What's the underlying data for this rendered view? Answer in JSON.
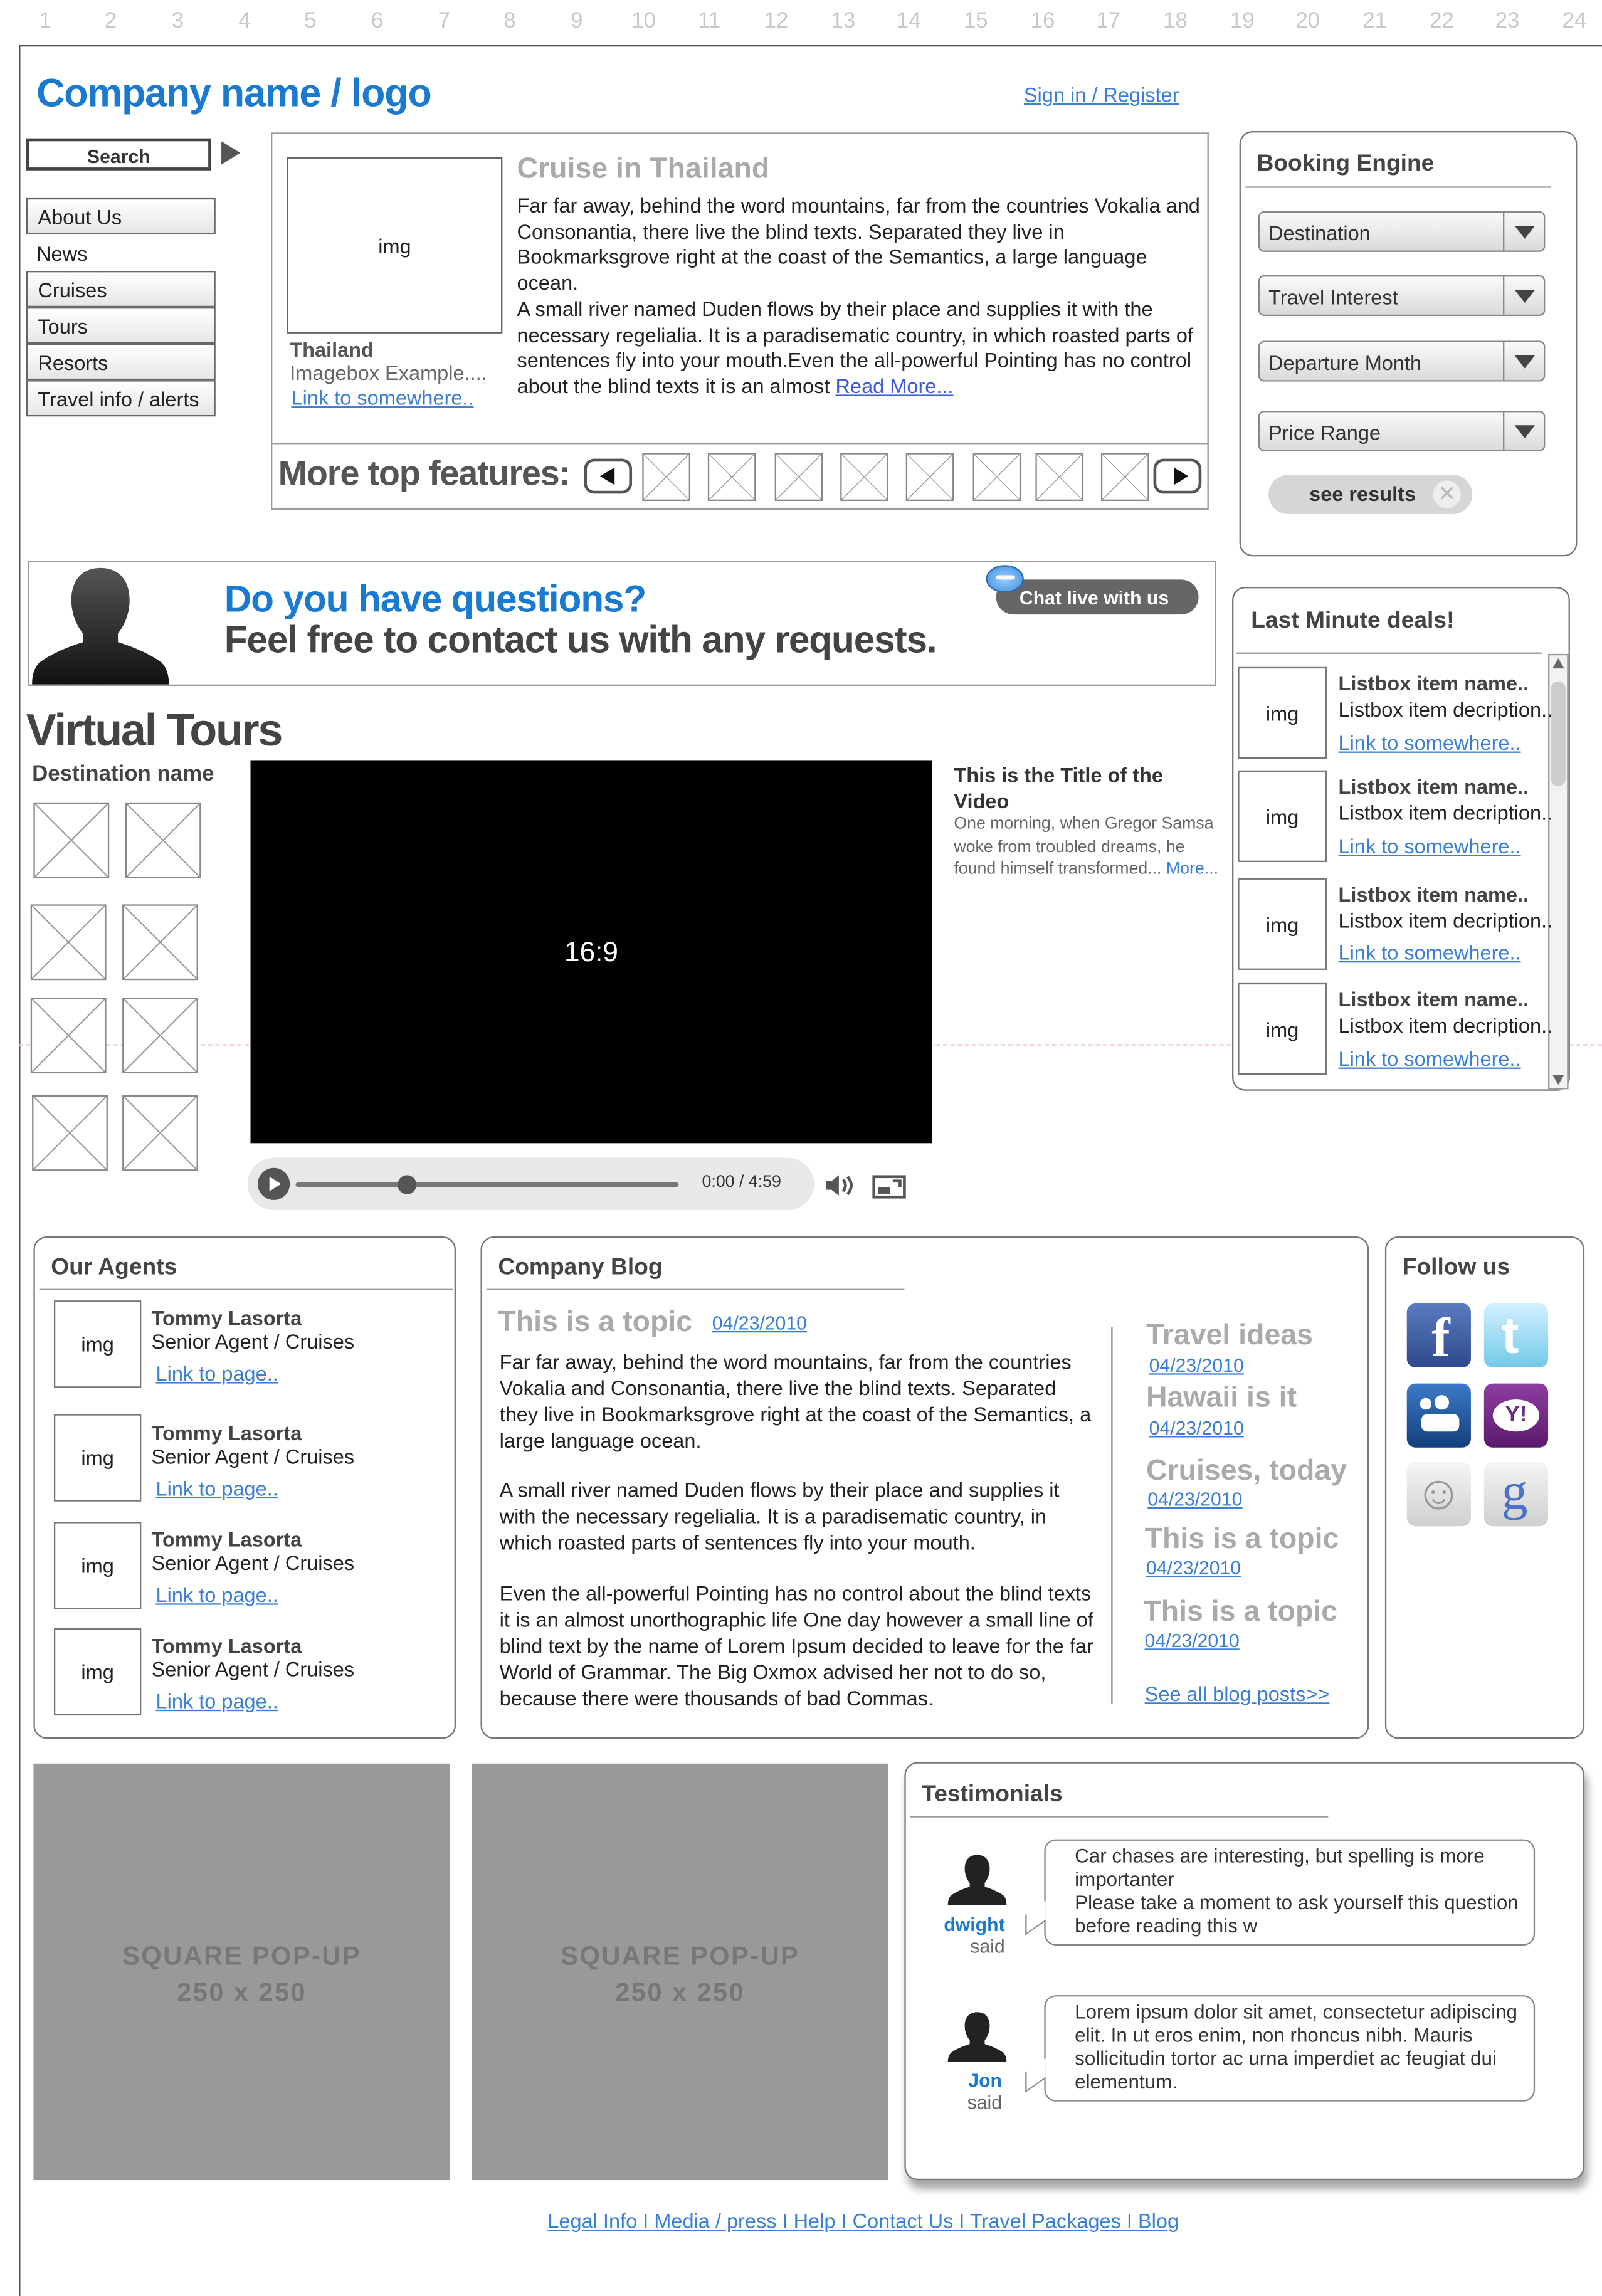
{
  "grid": [
    "1",
    "2",
    "3",
    "4",
    "5",
    "6",
    "7",
    "8",
    "9",
    "10",
    "11",
    "12",
    "13",
    "14",
    "15",
    "16",
    "17",
    "18",
    "19",
    "20",
    "21",
    "22",
    "23",
    "24"
  ],
  "header": {
    "logo": "Company name / logo",
    "signin": "Sign in / Register"
  },
  "search": {
    "label": "Search"
  },
  "nav": [
    "About Us",
    "News",
    "Cruises",
    "Tours",
    "Resorts",
    "Travel info / alerts"
  ],
  "feature": {
    "img": "img",
    "title": "Cruise in Thailand",
    "caption_title": "Thailand",
    "caption_text": "Imagebox Example....",
    "caption_link": "Link to somewhere..",
    "para1": "Far far away, behind the word mountains, far from the countries Vokalia and Consonantia, there live the blind texts. Separated they live in Bookmarksgrove right at the coast of the Semantics, a large language ocean.",
    "para2": "A small river named Duden flows by their place and supplies it with the necessary regelialia. It is a paradisematic country, in which roasted parts of sentences fly into your mouth.Even the all-powerful Pointing has no control about the blind texts it is an almost",
    "read_more": "Read More...",
    "more_label": "More top features:"
  },
  "booking": {
    "title": "Booking Engine",
    "selects": [
      "Destination",
      "Travel Interest",
      "Departure Month",
      "Price Range"
    ],
    "button": "see results"
  },
  "contact": {
    "q": "Do you have questions?",
    "sub": "Feel free to contact us with any requests.",
    "chat": "Chat live with us"
  },
  "deals": {
    "title": "Last Minute deals!",
    "items": [
      {
        "img": "img",
        "name": "Listbox item name..",
        "desc": "Listbox item decription...",
        "link": "Link to somewhere.."
      },
      {
        "img": "img",
        "name": "Listbox item name..",
        "desc": "Listbox item decription...",
        "link": "Link to somewhere.."
      },
      {
        "img": "img",
        "name": "Listbox item name..",
        "desc": "Listbox item decription...",
        "link": "Link to somewhere.."
      },
      {
        "img": "img",
        "name": "Listbox item name..",
        "desc": "Listbox item decription...",
        "link": "Link to somewhere.."
      }
    ]
  },
  "tours": {
    "heading": "Virtual Tours",
    "dest": "Destination name",
    "ratio": "16:9",
    "video_title": "This is the Title of the Video",
    "video_desc": "One morning, when Gregor Samsa woke from troubled dreams, he found himself transformed...",
    "video_more": "More...",
    "time_current": "0:00",
    "time_sep": "/",
    "time_total": "4:59",
    "progress": 0.29
  },
  "agents": {
    "title": "Our Agents",
    "items": [
      {
        "img": "img",
        "name": "Tommy Lasorta",
        "role": "Senior Agent  / Cruises",
        "link": "Link to page.."
      },
      {
        "img": "img",
        "name": "Tommy Lasorta",
        "role": "Senior Agent  / Cruises",
        "link": "Link to page.."
      },
      {
        "img": "img",
        "name": "Tommy Lasorta",
        "role": "Senior Agent  / Cruises",
        "link": "Link to page.."
      },
      {
        "img": "img",
        "name": "Tommy Lasorta",
        "role": "Senior Agent  / Cruises",
        "link": "Link to page.."
      }
    ]
  },
  "blog": {
    "title": "Company Blog",
    "topic": "This is a topic",
    "date": "04/23/2010",
    "p1": "Far far away, behind the word mountains, far from the countries Vokalia and Consonantia, there live the blind texts. Separated they live in Bookmarksgrove right at the coast of the Semantics, a large language ocean.",
    "p2": "A small river named Duden flows by their place and supplies it with the necessary regelialia. It is a paradisematic country, in which roasted parts of sentences fly into your mouth.",
    "p3": "Even the all-powerful Pointing has no control about the blind texts it is an almost unorthographic life One day however a small line of blind text by the name of Lorem Ipsum decided to leave for the far World of Grammar. The Big Oxmox advised her not to do so, because there were thousands of bad Commas.",
    "side": [
      {
        "t": "Travel ideas",
        "d": "04/23/2010"
      },
      {
        "t": "Hawaii is it",
        "d": "04/23/2010"
      },
      {
        "t": "Cruises, today",
        "d": "04/23/2010"
      },
      {
        "t": "This is a topic",
        "d": "04/23/2010"
      },
      {
        "t": "This is a topic",
        "d": "04/23/2010"
      }
    ],
    "see_all": "See all blog posts>>"
  },
  "follow": {
    "title": "Follow us",
    "icons": [
      "facebook-icon",
      "twitter-icon",
      "myspace-icon",
      "yahoo-icon",
      "smiley-icon",
      "google-icon"
    ]
  },
  "popups": [
    {
      "l1": "SQUARE POP-UP",
      "l2": "250 x 250"
    },
    {
      "l1": "SQUARE POP-UP",
      "l2": "250 x 250"
    }
  ],
  "testimonials": {
    "title": "Testimonials",
    "items": [
      {
        "text": "Car chases are interesting, but spelling is more importanter\nPlease take a moment to ask yourself this question before reading this w",
        "name": "dwight",
        "said": "said"
      },
      {
        "text": "Lorem ipsum dolor sit amet, consectetur adipiscing elit. In ut eros enim, non rhoncus nibh. Mauris sollicitudin tortor ac urna imperdiet ac feugiat dui elementum.",
        "name": "Jon",
        "said": "said"
      }
    ]
  },
  "footer": {
    "links": "Legal Info I Media / press I Help I Contact Us I Travel Packages I Blog"
  }
}
